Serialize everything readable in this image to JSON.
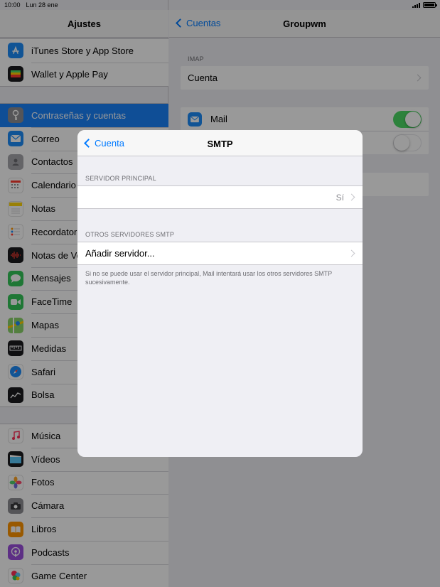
{
  "status_bar": {
    "time": "10:00",
    "date": "Lun 28 ene"
  },
  "sidebar": {
    "title": "Ajustes",
    "groups": [
      [
        {
          "label": "iTunes Store y App Store",
          "icon": "app-store-icon",
          "color": "#1d8cf8"
        },
        {
          "label": "Wallet y Apple Pay",
          "icon": "wallet-icon",
          "color": "#1c1c1e"
        }
      ],
      [
        {
          "label": "Contraseñas y cuentas",
          "icon": "key-icon",
          "color": "#8e8e93",
          "selected": true
        },
        {
          "label": "Correo",
          "icon": "mail-icon",
          "color": "#1d8cf8"
        },
        {
          "label": "Contactos",
          "icon": "contacts-icon",
          "color": "#9a9a9f"
        },
        {
          "label": "Calendario",
          "icon": "calendar-icon",
          "color": "#ffffff"
        },
        {
          "label": "Notas",
          "icon": "notes-icon",
          "color": "#ffd60a"
        },
        {
          "label": "Recordatorios",
          "icon": "reminders-icon",
          "color": "#ffffff"
        },
        {
          "label": "Notas de Voz",
          "icon": "voice-memos-icon",
          "color": "#1c1c1e"
        },
        {
          "label": "Mensajes",
          "icon": "messages-icon",
          "color": "#34c759"
        },
        {
          "label": "FaceTime",
          "icon": "facetime-icon",
          "color": "#34c759"
        },
        {
          "label": "Mapas",
          "icon": "maps-icon",
          "color": "#6cc04a"
        },
        {
          "label": "Medidas",
          "icon": "measure-icon",
          "color": "#1c1c1e"
        },
        {
          "label": "Safari",
          "icon": "safari-icon",
          "color": "#1d8cf8"
        },
        {
          "label": "Bolsa",
          "icon": "stocks-icon",
          "color": "#1c1c1e"
        }
      ],
      [
        {
          "label": "Música",
          "icon": "music-icon",
          "color": "#ffffff"
        },
        {
          "label": "Vídeos",
          "icon": "videos-icon",
          "color": "#1c1c1e"
        },
        {
          "label": "Fotos",
          "icon": "photos-icon",
          "color": "#ffffff"
        },
        {
          "label": "Cámara",
          "icon": "camera-icon",
          "color": "#8e8e93"
        },
        {
          "label": "Libros",
          "icon": "books-icon",
          "color": "#ff9500"
        },
        {
          "label": "Podcasts",
          "icon": "podcasts-icon",
          "color": "#9b4fde"
        },
        {
          "label": "Game Center",
          "icon": "game-center-icon",
          "color": "#ffffff"
        }
      ]
    ]
  },
  "detail": {
    "back_label": "Cuentas",
    "title": "Groupwm",
    "imap_section": "IMAP",
    "account_label": "Cuenta",
    "mail_label": "Mail",
    "mail_toggle": true,
    "second_toggle": false
  },
  "modal": {
    "back_label": "Cuenta",
    "title": "SMTP",
    "primary_section": "SERVIDOR PRINCIPAL",
    "primary_value": "Sí",
    "other_section": "OTROS SERVIDORES SMTP",
    "add_server_label": "Añadir servidor...",
    "footer_note": "Si no se puede usar el servidor principal, Mail intentará usar los otros servidores SMTP sucesivamente."
  }
}
